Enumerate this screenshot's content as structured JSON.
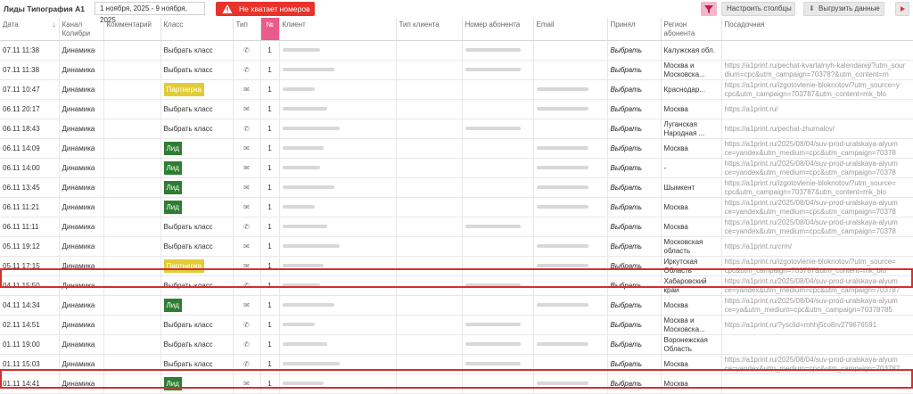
{
  "toolbar": {
    "title": "Лиды Типография А1",
    "date_range": "1 ноября, 2025 - 9 ноября, 2025",
    "warning": "Не хватает номеров",
    "configure_label": "Настроить столбцы",
    "export_label": "Выгрузить данные"
  },
  "columns": [
    "Дата",
    "Канал Колибри",
    "Комментарий",
    "Класс",
    "Тип",
    "№",
    "Клиент",
    "Тип клиента",
    "Номер абонента",
    "Email",
    "Принял",
    "Регион абонента",
    "Посадочная"
  ],
  "sort_arrow": "↓",
  "rows": [
    {
      "date": "07.11 11:38",
      "channel": "Динамика",
      "klass": "Выбрать класс",
      "type": "phone",
      "num": "1",
      "phone_blur": true,
      "email_blur": false,
      "accepted": "Выбрать",
      "region": "Калужская обл.",
      "url": ""
    },
    {
      "date": "07.11 11:38",
      "channel": "Динамика",
      "klass": "Выбрать класс",
      "type": "phone",
      "num": "1",
      "phone_blur": true,
      "email_blur": false,
      "accepted": "Выбрать",
      "region": "Москва и Московска...",
      "url": "https://a1print.ru/pechat-kvartalnyh-kalendarej/?utm_sour dium=cpc&utm_campaign=70378?&utm_content=m"
    },
    {
      "date": "07.11 10:47",
      "channel": "Динамика",
      "klass": "Партнерка",
      "type": "mail",
      "num": "1",
      "phone_blur": false,
      "email_blur": true,
      "accepted": "Выбрать",
      "region": "Краснодар...",
      "url": "https://a1print.ru/izgotovlenie-bloknotov/?utm_source=y cpc&utm_campaign=703787&utm_content=mk_blo"
    },
    {
      "date": "06.11 20:17",
      "channel": "Динамика",
      "klass": "Выбрать класс",
      "type": "mail",
      "num": "1",
      "phone_blur": false,
      "email_blur": true,
      "accepted": "Выбрать",
      "region": "Москва",
      "url": "https://a1print.ru/"
    },
    {
      "date": "06.11 18:43",
      "channel": "Динамика",
      "klass": "Выбрать класс",
      "type": "phone",
      "num": "1",
      "phone_blur": true,
      "email_blur": false,
      "accepted": "Выбрать",
      "region": "Луганская Народная ...",
      "url": "https://a1print.ru/pechat-zhurnalov/"
    },
    {
      "date": "06.11 14:09",
      "channel": "Динамика",
      "klass": "Лид",
      "type": "mail",
      "num": "1",
      "phone_blur": false,
      "email_blur": true,
      "accepted": "Выбрать",
      "region": "Москва",
      "url": "https://a1print.ru/2025/08/04/suv-prod-uralskaya-alyum ce=yandex&utm_medium=cpc&utm_campaign=70378"
    },
    {
      "date": "06.11 14:00",
      "channel": "Динамика",
      "klass": "Лид",
      "type": "mail",
      "num": "1",
      "phone_blur": false,
      "email_blur": true,
      "accepted": "Выбрать",
      "region": "-",
      "url": "https://a1print.ru/2025/08/04/suv-prod-uralskaya-alyum ce=yandex&utm_medium=cpc&utm_campaign=70378"
    },
    {
      "date": "06.11 13:45",
      "channel": "Динамика",
      "klass": "Лид",
      "type": "mail",
      "num": "1",
      "phone_blur": false,
      "email_blur": true,
      "accepted": "Выбрать",
      "region": "Шымкент",
      "url": "https://a1print.ru/izgotovlenie-bloknotov/?utm_source= cpc&utm_campaign=703787&utm_content=mk_blo"
    },
    {
      "date": "06.11 11:21",
      "channel": "Динамика",
      "klass": "Лид",
      "type": "mail",
      "num": "1",
      "phone_blur": false,
      "email_blur": true,
      "accepted": "Выбрать",
      "region": "Москва",
      "url": "https://a1print.ru/2025/08/04/suv-prod-uralskaya-alyum ce=yandex&utm_medium=cpc&utm_campaign=70378"
    },
    {
      "date": "06.11 11:11",
      "channel": "Динамика",
      "klass": "Выбрать класс",
      "type": "phone",
      "num": "1",
      "phone_blur": true,
      "email_blur": false,
      "accepted": "Выбрать",
      "region": "Москва",
      "url": "https://a1print.ru/2025/08/04/suv-prod-uralskaya-alyum ce=yandex&utm_medium=cpc&utm_campaign=70378"
    },
    {
      "date": "05.11 19:12",
      "channel": "Динамика",
      "klass": "Выбрать класс",
      "type": "mail",
      "num": "1",
      "phone_blur": false,
      "email_blur": true,
      "accepted": "Выбрать",
      "region": "Московская область",
      "url": "https://a1print.ru/crm/"
    },
    {
      "date": "05.11 17:15",
      "channel": "Динамика",
      "klass": "Партнерка",
      "type": "mail",
      "num": "1",
      "phone_blur": false,
      "email_blur": true,
      "accepted": "Выбрать",
      "region": "Иркутская Область",
      "url": "https://a1print.ru/izgotovlenie-bloknotov/?utm_source= cpc&utm_campaign=703787&utm_content=mk_blo"
    },
    {
      "date": "04.11 15:50",
      "channel": "Динамика",
      "klass": "Выбрать класс",
      "type": "phone",
      "num": "1",
      "phone_blur": true,
      "email_blur": false,
      "accepted": "Выбрать",
      "region": "Хабаровский край",
      "url": "https://a1print.ru/2025/08/04/suv-prod-uralskaya-alyum ce=yandex&utm_medium=cpc&utm_campaign=703787"
    },
    {
      "date": "04.11 14:34",
      "channel": "Динамика",
      "klass": "Лид",
      "type": "mail",
      "num": "1",
      "phone_blur": false,
      "email_blur": true,
      "accepted": "Выбрать",
      "region": "Москва",
      "url": "https://a1print.ru/2025/08/04/suv-prod-uralskaya-alyum ce=ya&utm_medium=cpc&utm_campaign=70378785"
    },
    {
      "date": "02.11 14:51",
      "channel": "Динамика",
      "klass": "Выбрать класс",
      "type": "phone",
      "num": "1",
      "phone_blur": true,
      "email_blur": false,
      "accepted": "Выбрать",
      "region": "Москва и Московска...",
      "url": "https://a1print.ru/?ysclid=mhhj5co8rv279676591"
    },
    {
      "date": "01.11 19:00",
      "channel": "Динамика",
      "klass": "Выбрать класс",
      "type": "phone",
      "num": "1",
      "phone_blur": true,
      "email_blur": true,
      "accepted": "Выбрать",
      "region": "Воронежская Область",
      "url": ""
    },
    {
      "date": "01.11 15:03",
      "channel": "Динамика",
      "klass": "Выбрать класс",
      "type": "phone",
      "num": "1",
      "phone_blur": true,
      "email_blur": false,
      "accepted": "Выбрать",
      "region": "Москва",
      "url": "https://a1print.ru/2025/08/04/suv-prod-uralskaya-alyum ce=yandex&utm_medium=cpc&utm_campaign=703787"
    },
    {
      "date": "01.11 14:41",
      "channel": "Динамика",
      "klass": "Лид",
      "type": "mail",
      "num": "1",
      "phone_blur": false,
      "email_blur": true,
      "accepted": "Выбрать",
      "region": "Москва",
      "url": ""
    }
  ],
  "colors": {
    "lid": "#2e7d32",
    "partner": "#e2cc36",
    "warning": "#e8322c",
    "num_header": "#e95b8d",
    "highlight": "#d32f2f"
  }
}
